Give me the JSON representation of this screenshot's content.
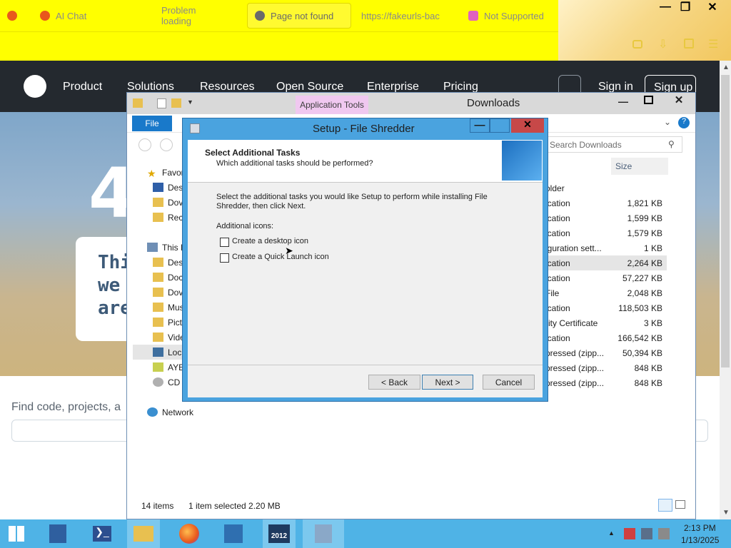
{
  "browser": {
    "tabs": [
      {
        "label": "AI Chat"
      },
      {
        "label": "Problem loading"
      },
      {
        "label": "Page not found"
      },
      {
        "label": "https://fakeurls-bac"
      },
      {
        "label": "Not Supported"
      }
    ],
    "new_tab": "+"
  },
  "github": {
    "nav": [
      "Product",
      "Solutions",
      "Resources",
      "Open Source",
      "Enterprise",
      "Pricing"
    ],
    "sign_in": "Sign in",
    "sign_up": "Sign up",
    "hero_char": "4",
    "card_lines": [
      "This",
      "we",
      "are"
    ],
    "search_label": "Find code, projects, a"
  },
  "explorer": {
    "title": "Downloads",
    "file_tab": "File",
    "app_tools": "Application Tools",
    "search_placeholder": "Search Downloads",
    "col_size": "Size",
    "nav": [
      {
        "label": "Favor",
        "icon": "star-icon"
      },
      {
        "label": "Des",
        "icon": "desktop-icon"
      },
      {
        "label": "Dov",
        "icon": "folder-icon"
      },
      {
        "label": "Rec",
        "icon": "folder-icon"
      },
      {
        "label": "This P",
        "icon": "computer-icon"
      },
      {
        "label": "Des",
        "icon": "folder-icon"
      },
      {
        "label": "Doc",
        "icon": "folder-icon"
      },
      {
        "label": "Dov",
        "icon": "folder-icon"
      },
      {
        "label": "Mus",
        "icon": "folder-icon"
      },
      {
        "label": "Pict",
        "icon": "folder-icon"
      },
      {
        "label": "Vide",
        "icon": "folder-icon"
      },
      {
        "label": "Loc",
        "icon": "drive-icon"
      },
      {
        "label": "AYE",
        "icon": "drive-icon"
      },
      {
        "label": "CD",
        "icon": "cd-icon"
      },
      {
        "label": "Network",
        "icon": "network-icon"
      }
    ],
    "files": [
      {
        "type": "older",
        "size": ""
      },
      {
        "type": "ication",
        "size": "1,821 KB"
      },
      {
        "type": "ication",
        "size": "1,599 KB"
      },
      {
        "type": "ication",
        "size": "1,579 KB"
      },
      {
        "type": "iguration sett...",
        "size": "1 KB"
      },
      {
        "type": "ication",
        "size": "2,264 KB"
      },
      {
        "type": "ication",
        "size": "57,227 KB"
      },
      {
        "type": "File",
        "size": "2,048 KB"
      },
      {
        "type": "ication",
        "size": "118,503 KB"
      },
      {
        "type": "rity Certificate",
        "size": "3 KB"
      },
      {
        "type": "ication",
        "size": "166,542 KB"
      },
      {
        "type": "pressed (zipp...",
        "size": "50,394 KB"
      },
      {
        "type": "pressed (zipp...",
        "size": "848 KB"
      },
      {
        "type": "pressed (zipp...",
        "size": "848 KB"
      }
    ],
    "status_items": "14 items",
    "status_selected": "1 item selected  2.20 MB"
  },
  "setup": {
    "title": "Setup - File Shredder",
    "header_title": "Select Additional Tasks",
    "header_subtitle": "Which additional tasks should be performed?",
    "body_text": "Select the additional tasks you would like Setup to perform while installing File Shredder, then click Next.",
    "group_label": "Additional icons:",
    "options": [
      {
        "label": "Create a desktop icon",
        "checked": false
      },
      {
        "label": "Create a Quick Launch icon",
        "checked": false
      }
    ],
    "back": "< Back",
    "next": "Next >",
    "cancel": "Cancel"
  },
  "taskbar": {
    "time": "2:13 PM",
    "date": "1/13/2025",
    "badge": "2012"
  }
}
